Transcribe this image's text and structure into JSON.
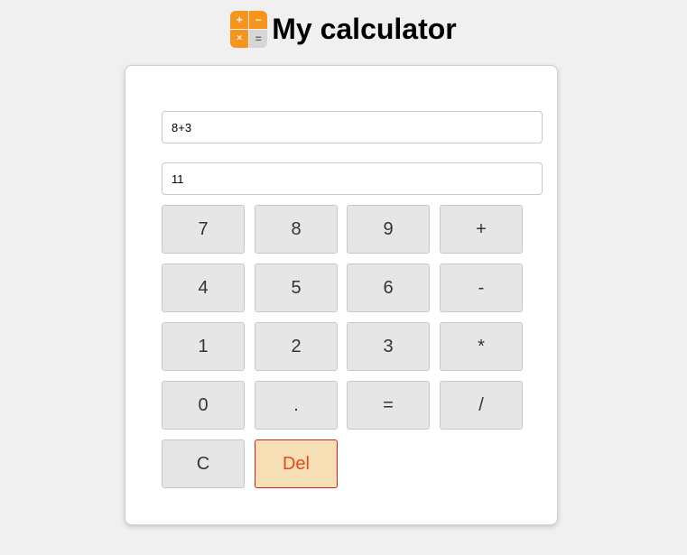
{
  "header": {
    "title": "My calculator",
    "logo": {
      "plus": "+",
      "minus": "−",
      "times": "×",
      "equals": "="
    }
  },
  "display": {
    "expression": "8+3",
    "result": "11"
  },
  "keypad": {
    "rows": [
      [
        "7",
        "8",
        "9",
        "+"
      ],
      [
        "4",
        "5",
        "6",
        "-"
      ],
      [
        "1",
        "2",
        "3",
        "*"
      ],
      [
        "0",
        ".",
        "=",
        "/"
      ],
      [
        "C",
        "Del"
      ]
    ]
  },
  "colors": {
    "background": "#f0f0f0",
    "card": "#ffffff",
    "key": "#e6e6e6",
    "del_background": "#f7dfb5",
    "del_border": "#cc2222",
    "del_text": "#e8481e",
    "logo_orange": "#f7941d"
  }
}
